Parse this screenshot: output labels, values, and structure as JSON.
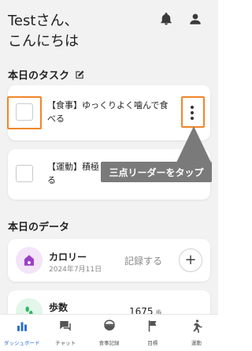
{
  "greeting": {
    "line1": "Testさん、",
    "line2": "こんにちは"
  },
  "tasks_section": {
    "title": "本日のタスク",
    "items": [
      {
        "text_line1": "【食事】ゆっくりよく噛んで食",
        "text_line2": "べる"
      },
      {
        "text_line1": "【運動】積極",
        "text_line2": "る"
      }
    ]
  },
  "callout": {
    "text": "三点リーダーをタップ"
  },
  "data_section": {
    "title": "本日のデータ",
    "calorie": {
      "label": "カロリー",
      "date": "2024年7月11日",
      "action": "記録する",
      "plus": "+"
    },
    "steps": {
      "label": "歩数",
      "value": "1675",
      "unit": "歩"
    }
  },
  "tabbar": {
    "items": [
      {
        "label": "ダッシュボード",
        "icon": "bar-chart-icon",
        "active": true
      },
      {
        "label": "チャット",
        "icon": "chat-icon"
      },
      {
        "label": "食事記録",
        "icon": "meal-bowl-icon"
      },
      {
        "label": "目標",
        "icon": "flag-icon"
      },
      {
        "label": "運動",
        "icon": "running-icon"
      }
    ]
  },
  "colors": {
    "accent_orange": "#f0862a",
    "active_tab_blue": "#2f6fd1",
    "calorie_icon_purple": "#9b3fc6",
    "steps_icon_green": "#2fb86a",
    "callout_gray": "#7a7a7a"
  }
}
